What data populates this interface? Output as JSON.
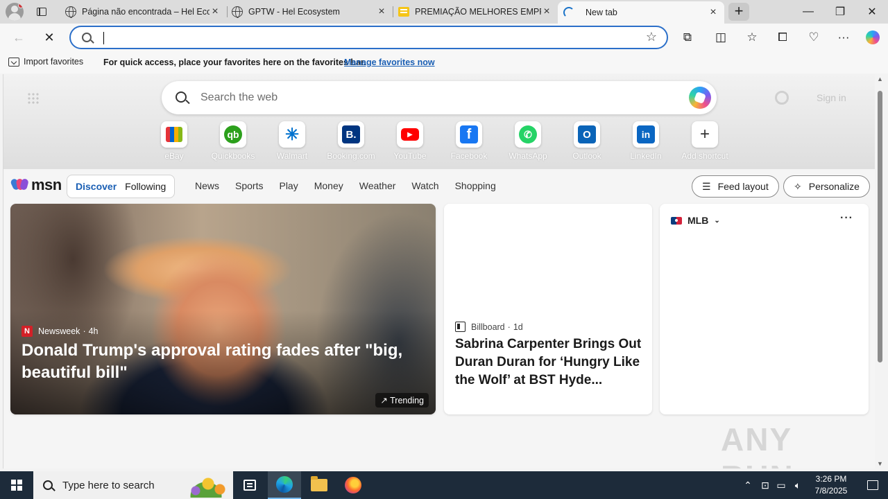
{
  "browser": {
    "tabs": [
      {
        "title": "Página não encontrada – Hel Ecos",
        "favicon": "globe-icon",
        "active": false
      },
      {
        "title": "GPTW - Hel Ecosystem",
        "favicon": "globe-icon",
        "active": false
      },
      {
        "title": "PREMIAÇÃO MELHORES EMPRESAS",
        "favicon": "slides-icon",
        "active": false
      },
      {
        "title": "New tab",
        "favicon": "loading-spinner-icon",
        "active": true
      }
    ],
    "close_glyph": "×",
    "new_tab_glyph": "+",
    "window_controls": {
      "minimize": "—",
      "restore": "❐",
      "close": "✕"
    },
    "address": {
      "value": "",
      "placeholder": ""
    },
    "favorites_bar": {
      "import_label": "Import favorites",
      "message": "For quick access, place your favorites here on the favorites bar.",
      "manage_link": "Manage favorites now"
    }
  },
  "newtab": {
    "search_placeholder": "Search the web",
    "signin_label": "Sign in",
    "shortcuts": [
      {
        "label": "eBay",
        "icon": "ebay-icon"
      },
      {
        "label": "Quickbooks",
        "icon": "quickbooks-icon"
      },
      {
        "label": "Walmart",
        "icon": "walmart-icon"
      },
      {
        "label": "Booking.com",
        "icon": "booking-icon"
      },
      {
        "label": "YouTube",
        "icon": "youtube-icon"
      },
      {
        "label": "Facebook",
        "icon": "facebook-icon"
      },
      {
        "label": "WhatsApp",
        "icon": "whatsapp-icon"
      },
      {
        "label": "Outlook",
        "icon": "outlook-icon"
      },
      {
        "label": "LinkedIn",
        "icon": "linkedin-icon"
      },
      {
        "label": "Add shortcut",
        "icon": "plus-icon"
      }
    ],
    "msn": {
      "logo_text": "msn",
      "feed_tabs": [
        {
          "label": "Discover",
          "selected": true
        },
        {
          "label": "Following",
          "selected": false
        }
      ],
      "nav_links": [
        "News",
        "Sports",
        "Play",
        "Money",
        "Weather",
        "Watch",
        "Shopping"
      ],
      "feed_layout_label": "Feed layout",
      "personalize_label": "Personalize"
    },
    "cards": {
      "hero": {
        "source": "Newsweek",
        "source_logo_letter": "N",
        "age": "4h",
        "title": "Donald Trump's approval rating fades after \"big, beautiful bill\"",
        "badge": "Trending"
      },
      "news": {
        "source": "Billboard",
        "age": "1d",
        "title": "Sabrina Carpenter Brings Out Duran Duran for ‘Hungry Like the Wolf’ at BST Hyde..."
      },
      "sports": {
        "title": "MLB",
        "more_glyph": "···"
      }
    },
    "watermark": "ANY RUN"
  },
  "taskbar": {
    "search_placeholder": "Type here to search",
    "time": "3:26 PM",
    "date": "7/8/2025"
  },
  "colors": {
    "accent": "#2b6fc9",
    "link": "#1a5fb4",
    "taskbar": "#1d2b3a"
  }
}
